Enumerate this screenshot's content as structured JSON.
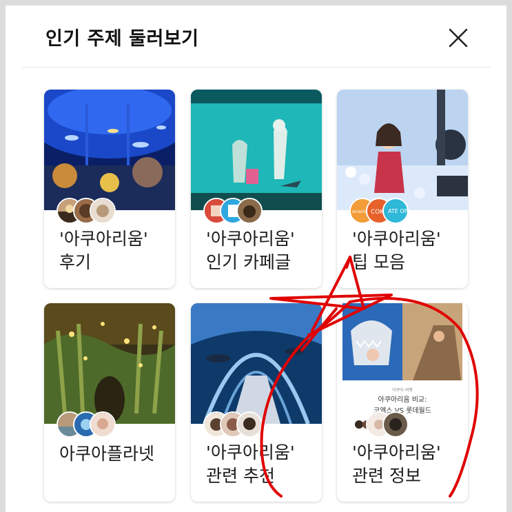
{
  "modal": {
    "title": "인기 주제 둘러보기",
    "close_icon": "close-icon"
  },
  "cards": [
    {
      "line1": "'아쿠아리움'",
      "line2": "후기"
    },
    {
      "line1": "'아쿠아리움'",
      "line2": "인기 카페글"
    },
    {
      "line1": "'아쿠아리움'",
      "line2": "팁 모음"
    },
    {
      "line1": "아쿠아플라넷",
      "line2": ""
    },
    {
      "line1": "'아쿠아리움'",
      "line2": "관련 추천"
    },
    {
      "line1": "'아쿠아리움'",
      "line2": "관련 정보"
    }
  ],
  "thumbnail_texts": {
    "card2_badge_left": "smartstore",
    "card2_badge_right": "COK",
    "card2_badge_third": "ATE OP",
    "card5_small": "아쿠아 여행",
    "card5_heading": "아쿠아리움 비교:",
    "card5_subheading": "코엑스 VS 롯데월드"
  },
  "colors": {
    "annotation_red": "#e00000",
    "title_text": "#111111"
  }
}
